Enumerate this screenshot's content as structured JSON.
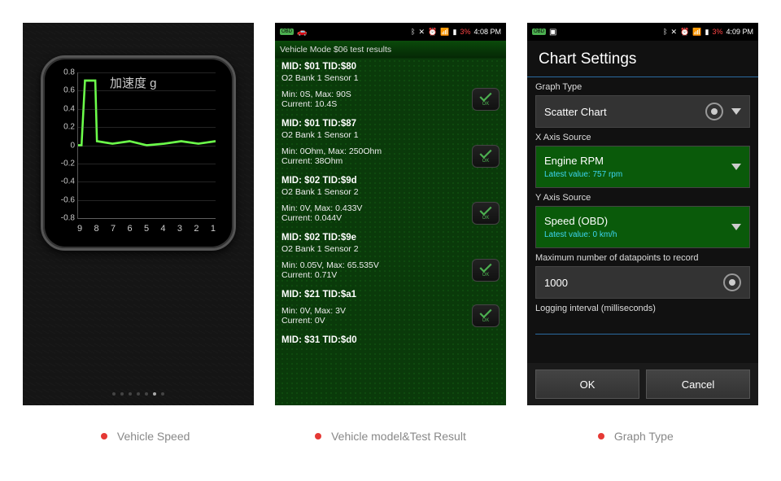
{
  "status": {
    "battery": "3%",
    "time1": "4:08 PM",
    "time2": "4:09 PM"
  },
  "screen1": {
    "gauge_title": "加速度 g",
    "ylabels": [
      "0.8",
      "0.6",
      "0.4",
      "0.2",
      "0",
      "-0.2",
      "-0.4",
      "-0.6",
      "-0.8"
    ],
    "xlabels": [
      "9",
      "8",
      "7",
      "6",
      "5",
      "4",
      "3",
      "2",
      "1"
    ]
  },
  "screen2": {
    "title": "Vehicle Mode $06 test results",
    "items": [
      {
        "hdr": "MID: $01 TID:$80",
        "desc": "O2 Bank 1 Sensor 1",
        "vals": "Min: 0S, Max: 90S",
        "cur": "Current: 10.4S"
      },
      {
        "hdr": "MID: $01 TID:$87",
        "desc": "O2 Bank 1 Sensor 1",
        "vals": "Min: 0Ohm, Max: 250Ohm",
        "cur": "Current: 38Ohm"
      },
      {
        "hdr": "MID: $02 TID:$9d",
        "desc": "O2 Bank 1 Sensor 2",
        "vals": "Min: 0V, Max: 0.433V",
        "cur": "Current: 0.044V"
      },
      {
        "hdr": "MID: $02 TID:$9e",
        "desc": "O2 Bank 1 Sensor 2",
        "vals": "Min: 0.05V, Max: 65.535V",
        "cur": "Current: 0.71V"
      },
      {
        "hdr": "MID: $21 TID:$a1",
        "desc": "",
        "vals": "Min: 0V, Max: 3V",
        "cur": "Current: 0V"
      },
      {
        "hdr": "MID: $31 TID:$d0",
        "desc": "",
        "vals": "",
        "cur": ""
      }
    ],
    "ok_label": "OK"
  },
  "screen3": {
    "title": "Chart Settings",
    "graph_type_label": "Graph Type",
    "graph_type_value": "Scatter Chart",
    "x_label": "X Axis Source",
    "x_value": "Engine RPM",
    "x_latest": "Latest value: 757 rpm",
    "y_label": "Y Axis Source",
    "y_value": "Speed (OBD)",
    "y_latest": "Latest value: 0 km/h",
    "max_label": "Maximum number of datapoints to record",
    "max_value": "1000",
    "interval_label": "Logging interval (milliseconds)",
    "ok": "OK",
    "cancel": "Cancel"
  },
  "captions": {
    "c1": "Vehicle Speed",
    "c2": "Vehicle model&Test Result",
    "c3": "Graph Type"
  },
  "chart_data": {
    "type": "line",
    "title": "加速度 g",
    "xlabel": "",
    "ylabel": "",
    "ylim": [
      -0.9,
      0.9
    ],
    "x": [
      9,
      8.8,
      8.6,
      8,
      7.9,
      7,
      6,
      5,
      4,
      3,
      2,
      1
    ],
    "values": [
      0.0,
      0.0,
      0.8,
      0.8,
      0.05,
      0.02,
      0.05,
      0.0,
      0.02,
      0.05,
      0.02,
      0.05
    ]
  }
}
